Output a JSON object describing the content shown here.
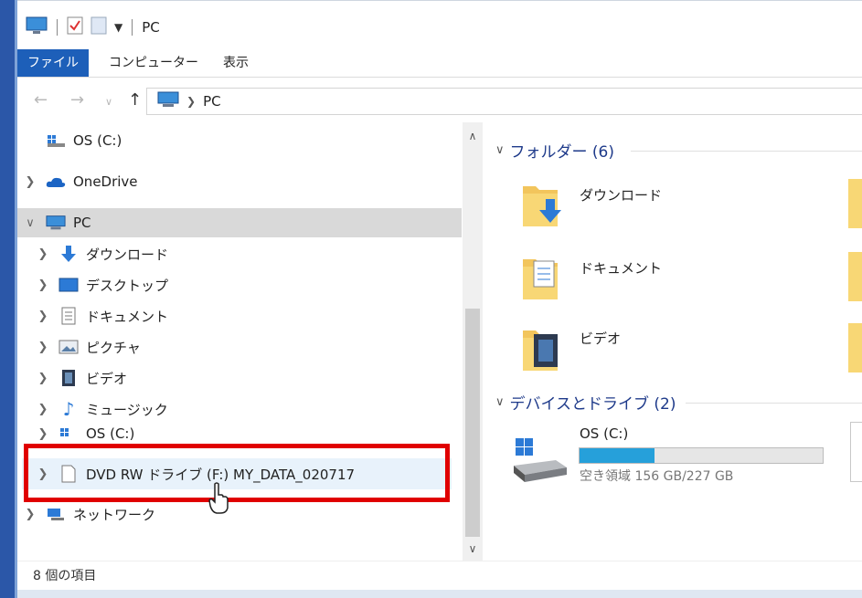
{
  "window": {
    "title": "PC"
  },
  "ribbon": {
    "tabs": [
      "ファイル",
      "コンピューター",
      "表示"
    ]
  },
  "address": {
    "location": "PC"
  },
  "nav": {
    "items": [
      {
        "label": "OS (C:)"
      },
      {
        "label": "OneDrive"
      },
      {
        "label": "PC"
      },
      {
        "label": "ダウンロード"
      },
      {
        "label": "デスクトップ"
      },
      {
        "label": "ドキュメント"
      },
      {
        "label": "ピクチャ"
      },
      {
        "label": "ビデオ"
      },
      {
        "label": "ミュージック"
      },
      {
        "label": "OS (C:)"
      },
      {
        "label": "DVD RW ドライブ (F:) MY_DATA_020717"
      },
      {
        "label": "ネットワーク"
      }
    ]
  },
  "content": {
    "folders_header": "フォルダー (6)",
    "folders": [
      "ダウンロード",
      "ドキュメント",
      "ビデオ"
    ],
    "devices_header": "デバイスとドライブ (2)",
    "drive": {
      "name": "OS (C:)",
      "free_text": "空き領域 156 GB/227 GB",
      "used_fraction": 0.31
    }
  },
  "status": {
    "count_text": "8 個の項目"
  },
  "colors": {
    "accent": "#1d5fb9",
    "highlight": "#e00000",
    "drive_fill": "#26a0da"
  }
}
